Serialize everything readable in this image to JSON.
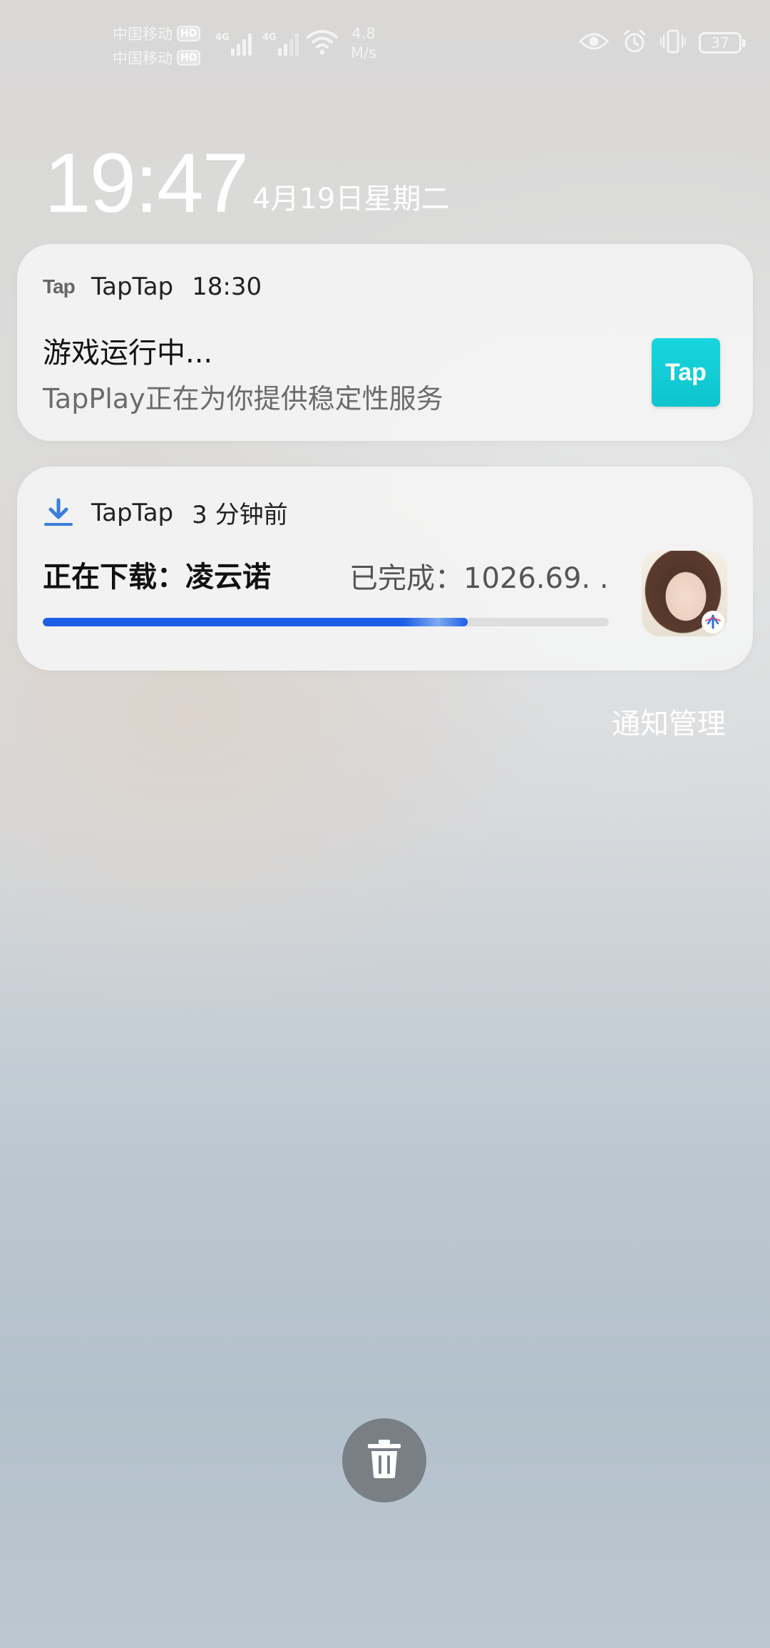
{
  "status_bar": {
    "carrier1": "中国移动",
    "carrier2": "中国移动",
    "hd_label": "HD",
    "network1": "4G",
    "network2": "4G",
    "speed_value": "4.8",
    "speed_unit": "M/s",
    "battery": "37",
    "icons": [
      "eye-icon",
      "alarm-icon",
      "vibrate-icon",
      "battery-icon",
      "wifi-icon",
      "signal-icon"
    ]
  },
  "lockscreen": {
    "time": "19:47",
    "date": "4月19日星期二"
  },
  "notifications": [
    {
      "app_logo": "Tap",
      "app": "TapTap",
      "time": "18:30",
      "title": "游戏运行中...",
      "body": "TapPlay正在为你提供稳定性服务",
      "icon_text": "Tap",
      "accent": "#14cbd6"
    },
    {
      "app": "TapTap",
      "time": "3 分钟前",
      "title": "正在下载：凌云诺",
      "status": "已完成：1026.69. .",
      "progress": 0.75,
      "progress_color": "#1a5fe6"
    }
  ],
  "manage_label": "通知管理"
}
